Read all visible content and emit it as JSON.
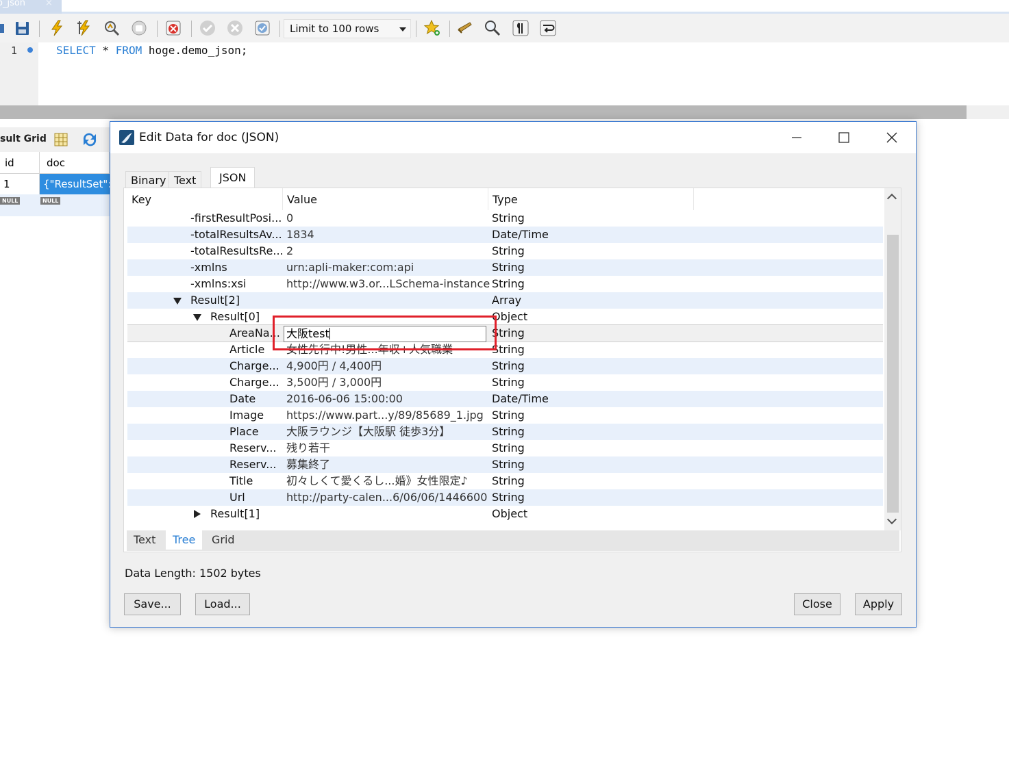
{
  "query_tab": {
    "label": "o_json",
    "close": "×"
  },
  "toolbar": {
    "limit_select": "Limit to 100 rows"
  },
  "editor": {
    "line_number": "1",
    "code": {
      "kw1": "SELECT",
      "star": " * ",
      "kw2": "FROM",
      "rest": " hoge.demo_json;"
    }
  },
  "result_grid": {
    "label": "sult Grid",
    "columns": [
      "id",
      "doc"
    ],
    "row": {
      "id": "1",
      "doc": "{\"ResultSet\":"
    },
    "null_label": "NULL"
  },
  "dialog": {
    "title": "Edit Data for doc (JSON)",
    "tabs": [
      "Binary",
      "Text",
      "JSON"
    ],
    "active_tab": "JSON",
    "tree_headers": {
      "key": "Key",
      "value": "Value",
      "type": "Type"
    },
    "rows": [
      {
        "key": "-firstResultPosi...",
        "value": "0",
        "type": "String"
      },
      {
        "key": "-totalResultsAv...",
        "value": "1834",
        "type": "Date/Time"
      },
      {
        "key": "-totalResultsRe...",
        "value": "2",
        "type": "String"
      },
      {
        "key": "-xmlns",
        "value": "urn:apli-maker:com:api",
        "type": "String"
      },
      {
        "key": "-xmlns:xsi",
        "value": "http://www.w3.or...LSchema-instance",
        "type": "String"
      },
      {
        "key": "Result[2]",
        "value": "",
        "type": "Array"
      },
      {
        "key": "Result[0]",
        "value": "",
        "type": "Object"
      },
      {
        "key": "AreaNa...",
        "value": "大阪test",
        "type": "String"
      },
      {
        "key": "Article",
        "value": "女性先行中!男性...年収+人気職業",
        "type": "String"
      },
      {
        "key": "Charge...",
        "value": "4,900円 / 4,400円",
        "type": "String"
      },
      {
        "key": "Charge...",
        "value": "3,500円 / 3,000円",
        "type": "String"
      },
      {
        "key": "Date",
        "value": "2016-06-06 15:00:00",
        "type": "Date/Time"
      },
      {
        "key": "Image",
        "value": "https://www.part...y/89/85689_1.jpg",
        "type": "String"
      },
      {
        "key": "Place",
        "value": "大阪ラウンジ【大阪駅 徒歩3分】",
        "type": "String"
      },
      {
        "key": "Reserv...",
        "value": "残り若干",
        "type": "String"
      },
      {
        "key": "Reserv...",
        "value": "募集終了",
        "type": "String"
      },
      {
        "key": "Title",
        "value": "初々しくて愛くるし...婚》女性限定♪",
        "type": "String"
      },
      {
        "key": "Url",
        "value": "http://party-calen...6/06/06/1446600",
        "type": "String"
      },
      {
        "key": "Result[1]",
        "value": "",
        "type": "Object"
      }
    ],
    "bottom_tabs": [
      "Text",
      "Tree",
      "Grid"
    ],
    "active_bottom_tab": "Tree",
    "data_length": "Data Length: 1502 bytes",
    "buttons": {
      "save": "Save...",
      "load": "Load...",
      "close": "Close",
      "apply": "Apply"
    }
  },
  "colors": {
    "accent": "#2a7fd4",
    "highlight": "#e0202a",
    "alt_row": "#e8f0fb"
  }
}
